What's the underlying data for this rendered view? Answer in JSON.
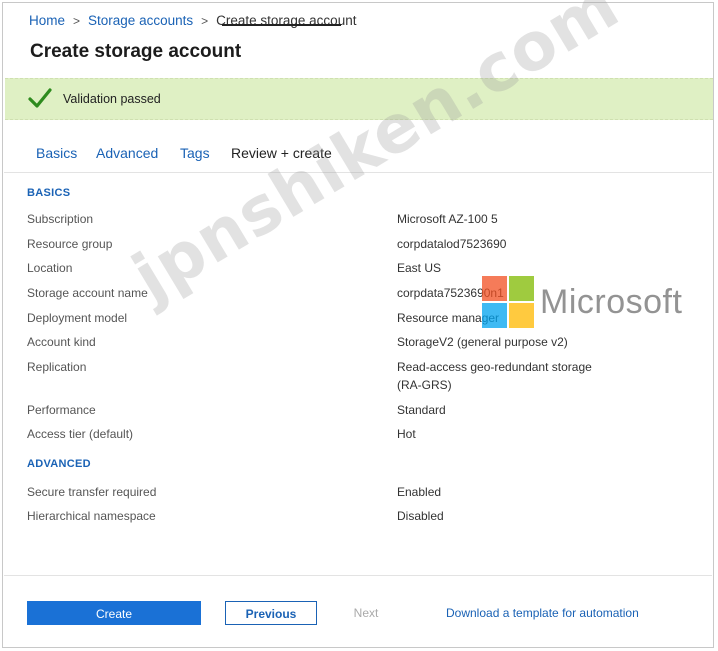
{
  "breadcrumb": {
    "home": "Home",
    "storage_accounts": "Storage accounts",
    "current": "Create storage account"
  },
  "page_title": "Create storage account",
  "validation": {
    "message": "Validation passed",
    "color": "#dff0c4",
    "check_color": "#2e8b1e"
  },
  "tabs": [
    {
      "label": "Basics"
    },
    {
      "label": "Advanced"
    },
    {
      "label": "Tags"
    },
    {
      "label": "Review + create"
    }
  ],
  "sections": {
    "basics": {
      "title": "BASICS",
      "rows": [
        {
          "label": "Subscription",
          "value": "Microsoft AZ-100 5"
        },
        {
          "label": "Resource group",
          "value": "corpdatalod7523690"
        },
        {
          "label": "Location",
          "value": "East US"
        },
        {
          "label": "Storage account name",
          "value": "corpdata7523690n1"
        },
        {
          "label": "Deployment model",
          "value": "Resource manager"
        },
        {
          "label": "Account kind",
          "value": "StorageV2 (general purpose v2)"
        },
        {
          "label": "Replication",
          "value": "Read-access geo-redundant storage",
          "value2": "(RA-GRS)"
        },
        {
          "label": "Performance",
          "value": "Standard"
        },
        {
          "label": "Access tier (default)",
          "value": "Hot"
        }
      ]
    },
    "advanced": {
      "title": "ADVANCED",
      "rows": [
        {
          "label": "Secure transfer required",
          "value": "Enabled"
        },
        {
          "label": "Hierarchical namespace",
          "value": "Disabled"
        }
      ]
    }
  },
  "footer": {
    "create_label": "Create",
    "previous_label": "Previous",
    "next_label": "Next",
    "download_label": "Download a template for automation"
  },
  "overlay": {
    "watermark": "jpnshiken.com",
    "logo_text": "Microsoft"
  },
  "colors": {
    "accent": "#1a62b5",
    "primary_button": "#1a71d6"
  }
}
